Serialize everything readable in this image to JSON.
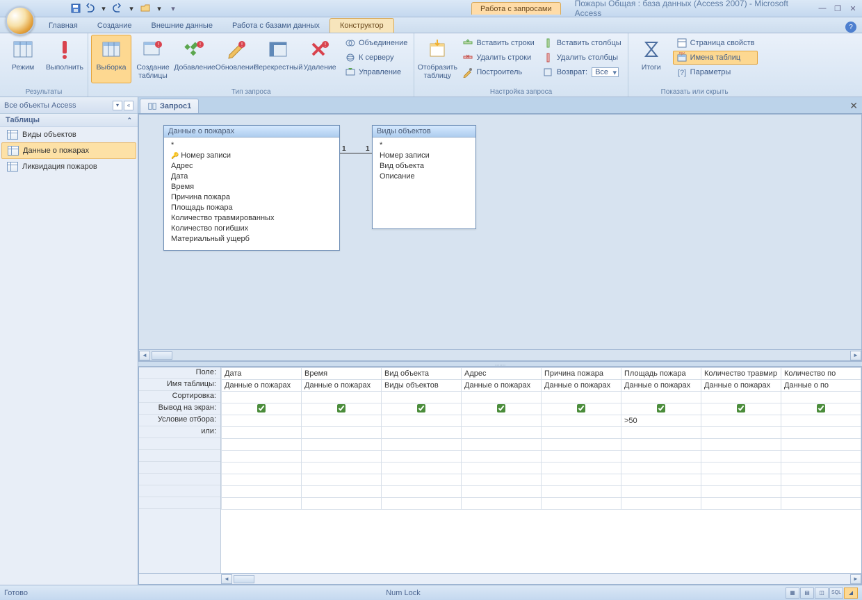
{
  "window": {
    "context_tab": "Работа с запросами",
    "title": "Пожары Общая : база данных (Access 2007) - Microsoft Access"
  },
  "tabs": {
    "home": "Главная",
    "create": "Создание",
    "external": "Внешние данные",
    "dbtools": "Работа с базами данных",
    "design": "Конструктор"
  },
  "ribbon": {
    "results": {
      "group": "Результаты",
      "view": "Режим",
      "run": "Выполнить"
    },
    "querytype": {
      "group": "Тип запроса",
      "select": "Выборка",
      "maketable": "Создание\nтаблицы",
      "append": "Добавление",
      "update": "Обновление",
      "crosstab": "Перекрестный",
      "delete": "Удаление",
      "union": "Объединение",
      "passthrough": "К серверу",
      "datadef": "Управление"
    },
    "querysetup": {
      "group": "Настройка запроса",
      "showtable": "Отобразить\nтаблицу",
      "insrows": "Вставить строки",
      "delrows": "Удалить строки",
      "builder": "Построитель",
      "inscols": "Вставить столбцы",
      "delcols": "Удалить столбцы",
      "return": "Возврат:",
      "return_val": "Все"
    },
    "showhide": {
      "group": "Показать или скрыть",
      "totals": "Итоги",
      "propsheet": "Страница свойств",
      "tablenames": "Имена таблиц",
      "params": "Параметры"
    }
  },
  "nav": {
    "header": "Все объекты Access",
    "section": "Таблицы",
    "items": [
      "Виды объектов",
      "Данные о пожарах",
      "Ликвидация пожаров"
    ],
    "selected_index": 1
  },
  "doc": {
    "tab": "Запрос1"
  },
  "tables": {
    "t1": {
      "title": "Данные о пожарах",
      "fields": [
        "*",
        "Номер записи",
        "Адрес",
        "Дата",
        "Время",
        "Причина пожара",
        "Площадь пожара",
        "Количество травмированных",
        "Количество погибших",
        "Материальный ущерб"
      ],
      "pk_index": 1
    },
    "t2": {
      "title": "Виды объектов",
      "fields": [
        "*",
        "Номер записи",
        "Вид объекта",
        "Описание"
      ]
    },
    "rel": {
      "left": "1",
      "right": "1"
    }
  },
  "grid": {
    "labels": {
      "field": "Поле:",
      "table": "Имя таблицы:",
      "sort": "Сортировка:",
      "show": "Вывод на экран:",
      "criteria": "Условие отбора:",
      "or": "или:"
    },
    "cols": [
      {
        "field": "Дата",
        "table": "Данные о пожарах",
        "show": true,
        "criteria": ""
      },
      {
        "field": "Время",
        "table": "Данные о пожарах",
        "show": true,
        "criteria": ""
      },
      {
        "field": "Вид объекта",
        "table": "Виды объектов",
        "show": true,
        "criteria": ""
      },
      {
        "field": "Адрес",
        "table": "Данные о пожарах",
        "show": true,
        "criteria": ""
      },
      {
        "field": "Причина пожара",
        "table": "Данные о пожарах",
        "show": true,
        "criteria": ""
      },
      {
        "field": "Площадь пожара",
        "table": "Данные о пожарах",
        "show": true,
        "criteria": ">50"
      },
      {
        "field": "Количество травмир",
        "table": "Данные о пожарах",
        "show": true,
        "criteria": ""
      },
      {
        "field": "Количество по",
        "table": "Данные о по",
        "show": true,
        "criteria": ""
      }
    ]
  },
  "status": {
    "ready": "Готово",
    "numlock": "Num Lock"
  }
}
